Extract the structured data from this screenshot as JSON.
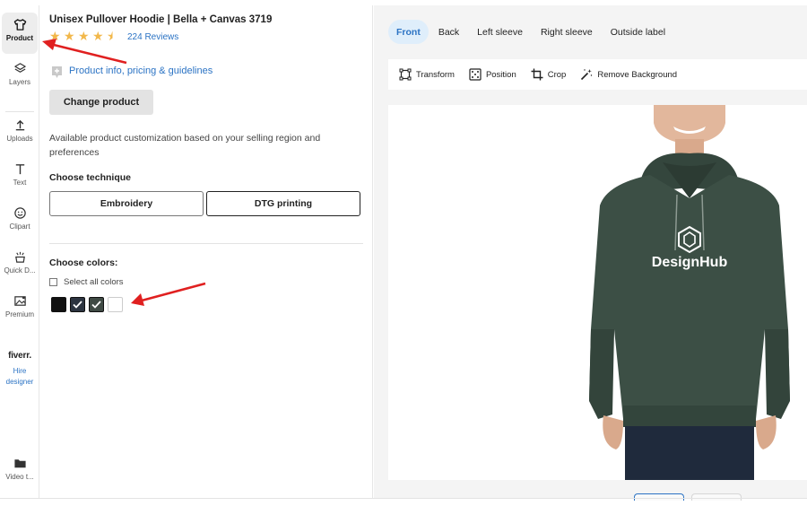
{
  "rail": {
    "items": [
      {
        "label": "Product",
        "icon": "tshirt-icon"
      },
      {
        "label": "Layers",
        "icon": "layers-icon"
      },
      {
        "label": "Uploads",
        "icon": "upload-icon"
      },
      {
        "label": "Text",
        "icon": "text-icon"
      },
      {
        "label": "Clipart",
        "icon": "smiley-icon"
      },
      {
        "label": "Quick D...",
        "icon": "quick-design-icon"
      },
      {
        "label": "Premium",
        "icon": "premium-image-icon"
      }
    ],
    "fiverr": "fiverr.",
    "hire_designer": "Hire designer",
    "video_label": "Video t..."
  },
  "panel": {
    "title": "Unisex Pullover Hoodie | Bella + Canvas 3719",
    "rating": 4.5,
    "reviews": "224 Reviews",
    "info_link": "Product info, pricing & guidelines",
    "change_product": "Change product",
    "availability_note": "Available product customization based on your selling region and preferences",
    "technique_heading": "Choose technique",
    "techniques": [
      "Embroidery",
      "DTG printing"
    ],
    "colors_heading": "Choose colors:",
    "select_all": "Select all colors",
    "swatches": [
      {
        "color": "#111111",
        "checked": false
      },
      {
        "color": "#2c3440",
        "checked": true
      },
      {
        "color": "#3f4a44",
        "checked": true
      },
      {
        "color": "#ffffff",
        "checked": false
      }
    ]
  },
  "canvas": {
    "tabs": [
      "Front",
      "Back",
      "Left sleeve",
      "Right sleeve",
      "Outside label"
    ],
    "active_tab": "Front",
    "tools": [
      {
        "label": "Transform",
        "icon": "transform-icon"
      },
      {
        "label": "Position",
        "icon": "position-icon"
      },
      {
        "label": "Crop",
        "icon": "crop-icon"
      },
      {
        "label": "Remove Background",
        "icon": "magic-wand-icon"
      }
    ],
    "logo_text": "DesignHub",
    "hoodie_color": "#3c4f45"
  },
  "colors": {
    "accent": "#2b73c4",
    "annotation_arrow": "#e02020"
  }
}
